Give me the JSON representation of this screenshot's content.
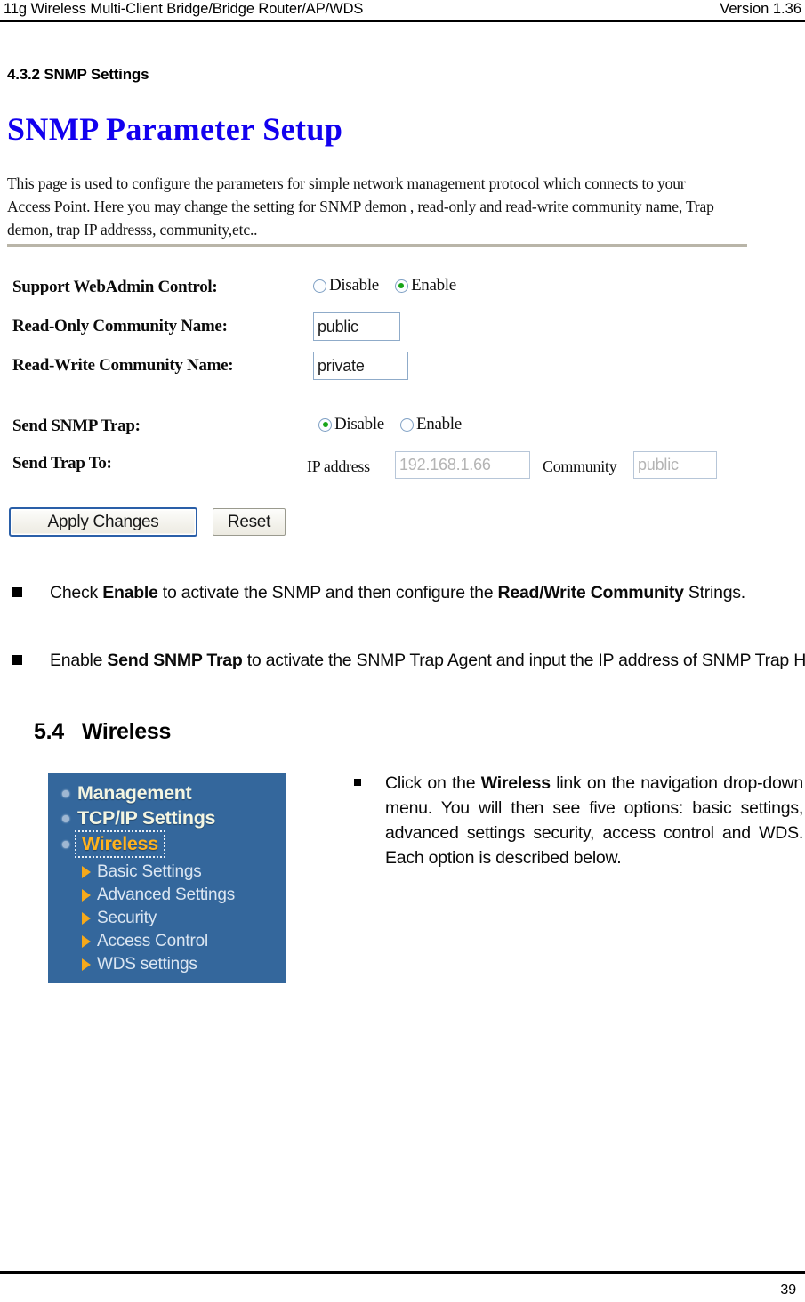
{
  "header": {
    "left_title": "11g Wireless Multi-Client Bridge/Bridge Router/AP/WDS",
    "version": "Version 1.36"
  },
  "section": {
    "heading": "4.3.2 SNMP Settings"
  },
  "snmp_panel": {
    "title": "SNMP Parameter Setup",
    "description": "This page is used to configure the parameters for simple network management protocol which connects to your Access Point. Here you may change the setting for SNMP demon , read-only and read-write community name, Trap demon, trap IP addresss, community,etc..",
    "rows": {
      "webadmin": {
        "label": "Support WebAdmin Control:",
        "option_disable": "Disable",
        "option_enable": "Enable",
        "selected": "Enable"
      },
      "read_only": {
        "label": "Read-Only Community Name:",
        "value": "public"
      },
      "read_write": {
        "label": "Read-Write Community Name:",
        "value": "private"
      },
      "send_trap": {
        "label": "Send SNMP Trap:",
        "option_disable": "Disable",
        "option_enable": "Enable",
        "selected": "Disable"
      },
      "send_trap_to": {
        "label": "Send Trap To:",
        "ip_label": "IP address",
        "ip_value": "192.168.1.66",
        "community_label": "Community",
        "community_value": "public"
      }
    },
    "buttons": {
      "apply": "Apply Changes",
      "reset": "Reset"
    }
  },
  "notes": {
    "bullet_1": {
      "part1": "Check ",
      "bold1": "Enable",
      "part2": " to activate the SNMP and then configure the ",
      "bold2": "Read/Write Community",
      "part3": " Strings."
    },
    "bullet_2": {
      "part1": "Enable ",
      "bold1": "Send SNMP Trap",
      "part2": " to activate the SNMP Trap Agent and input the IP address of SNMP Trap Host."
    }
  },
  "wireless_section": {
    "number": "5.4",
    "title": "Wireless",
    "nav_menu": {
      "top_items": [
        {
          "label": "Management",
          "active": false
        },
        {
          "label": "TCP/IP Settings",
          "active": false
        },
        {
          "label": "Wireless",
          "active": true
        }
      ],
      "sub_items": [
        {
          "label": "Basic Settings"
        },
        {
          "label": "Advanced Settings"
        },
        {
          "label": "Security"
        },
        {
          "label": "Access Control"
        },
        {
          "label": "WDS settings"
        }
      ]
    },
    "note": {
      "part1": "Click on the ",
      "bold1": "Wireless",
      "part2": " link on the navigation drop-down menu. You will then see five options: basic settings, advanced settings security, access control and WDS. Each option is described below."
    }
  },
  "footer": {
    "page_number": "39"
  },
  "colors": {
    "panel_title": "#1200ef",
    "nav_background": "#34679c",
    "nav_active": "#ffb21e",
    "radio_dot": "#17a417",
    "primary_button_border": "#2a5fa8"
  }
}
